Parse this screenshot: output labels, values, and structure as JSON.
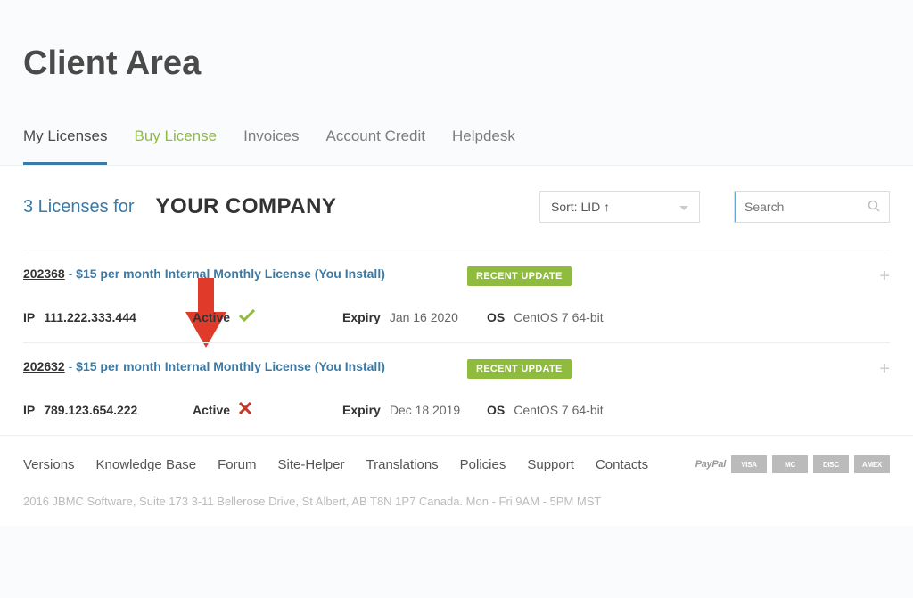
{
  "page": {
    "title": "Client Area"
  },
  "tabs": [
    {
      "label": "My Licenses",
      "state": "active"
    },
    {
      "label": "Buy License",
      "state": "highlight"
    },
    {
      "label": "Invoices",
      "state": ""
    },
    {
      "label": "Account Credit",
      "state": ""
    },
    {
      "label": "Helpdesk",
      "state": ""
    }
  ],
  "summary": {
    "count_text": "3 Licenses for",
    "company": "YOUR COMPANY"
  },
  "sort": {
    "label": "Sort: LID ↑"
  },
  "search": {
    "placeholder": "Search"
  },
  "licenses": [
    {
      "id": "202368",
      "price": "$15",
      "per_label": "per month",
      "name": "Internal Monthly License (You Install)",
      "badge": "RECENT UPDATE",
      "ip_label": "IP",
      "ip": "111.222.333.444",
      "active_label": "Active",
      "active_ok": true,
      "expiry_label": "Expiry",
      "expiry": "Jan 16 2020",
      "os_label": "OS",
      "os": "CentOS 7 64-bit"
    },
    {
      "id": "202632",
      "price": "$15",
      "per_label": "per month",
      "name": "Internal Monthly License (You Install)",
      "badge": "RECENT UPDATE",
      "ip_label": "IP",
      "ip": "789.123.654.222",
      "active_label": "Active",
      "active_ok": false,
      "expiry_label": "Expiry",
      "expiry": "Dec 18 2019",
      "os_label": "OS",
      "os": "CentOS 7 64-bit"
    }
  ],
  "footer_links": [
    "Versions",
    "Knowledge Base",
    "Forum",
    "Site-Helper",
    "Translations",
    "Policies",
    "Support",
    "Contacts"
  ],
  "payment_cards": [
    "PayPal",
    "VISA",
    "MC",
    "DISC",
    "AMEX"
  ],
  "copyright": "2016 JBMC Software, Suite 173 3-11 Bellerose Drive, St Albert, AB T8N 1P7 Canada. Mon - Fri 9AM - 5PM MST"
}
